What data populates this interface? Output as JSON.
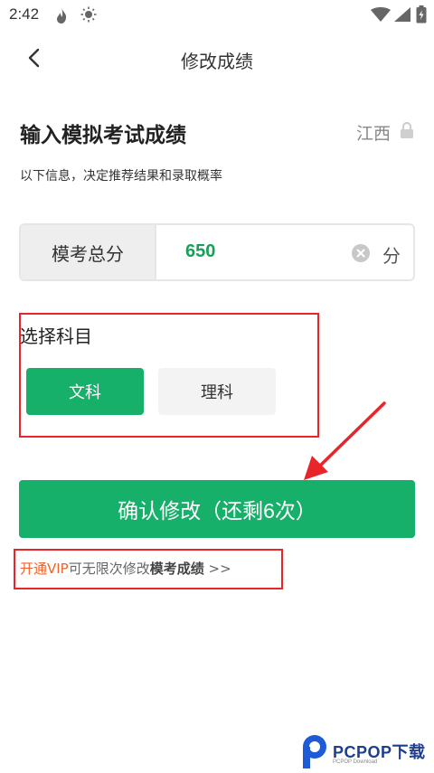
{
  "status": {
    "time": "2:42"
  },
  "header": {
    "title": "修改成绩"
  },
  "main": {
    "heading": "输入模拟考试成绩",
    "region": "江西",
    "description": "以下信息，决定推荐结果和录取概率",
    "score": {
      "label": "模考总分",
      "value": "650",
      "unit": "分"
    },
    "subject": {
      "title": "选择科目",
      "options": [
        "文科",
        "理科"
      ],
      "selected": "文科"
    },
    "confirm_label": "确认修改（还剩6次）",
    "vip": {
      "link": "开通VIP",
      "middle": "可无限次修改",
      "strong": "模考成绩",
      "tail": " >>"
    }
  },
  "colors": {
    "accent": "#17b06b",
    "score_text": "#1a9f5a",
    "vip_link": "#f0632a",
    "annotation_red": "#e8262a"
  },
  "watermark": {
    "brand": "PCPOP下载",
    "sub": "PCPOP Download"
  }
}
